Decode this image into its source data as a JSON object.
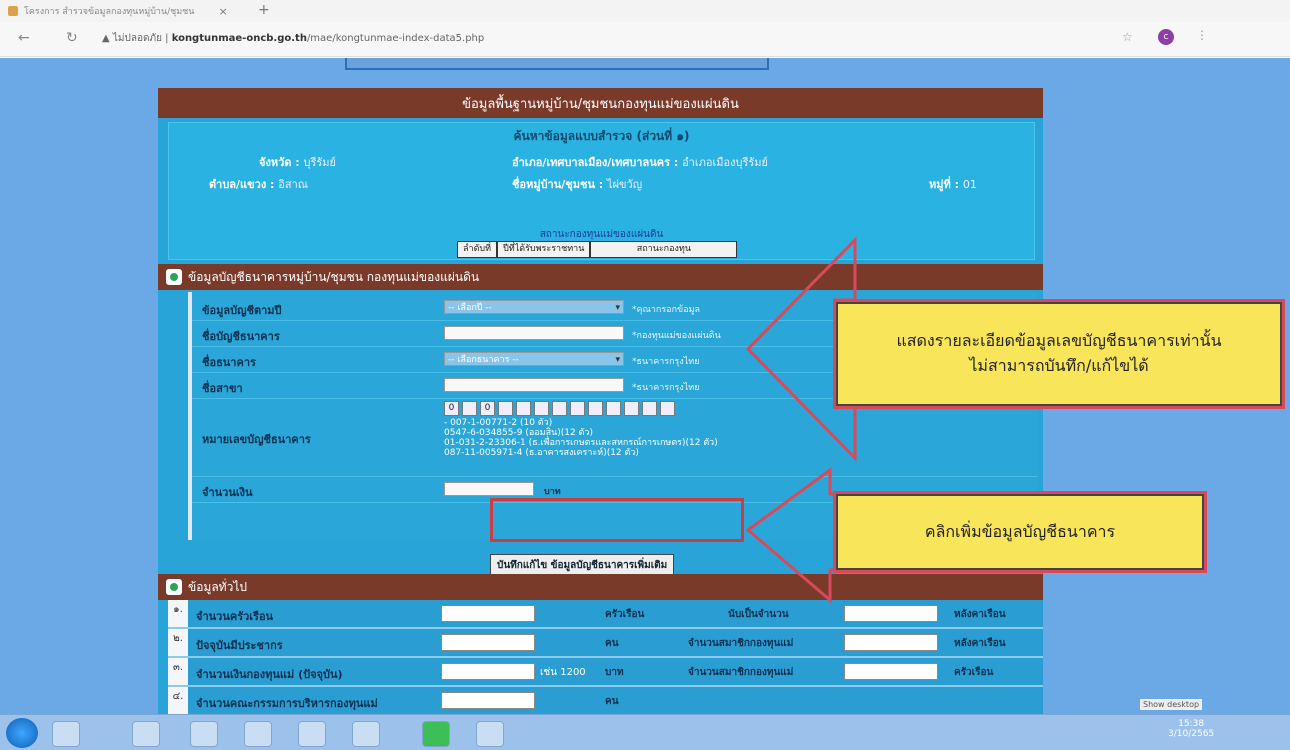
{
  "browser": {
    "tab_title": "โครงการ สำรวจข้อมูลกองทุนหมู่บ้าน/ชุมชน",
    "tab_close": "×",
    "new_tab": "+",
    "url_security": "ไม่ปลอดภัย",
    "url_host": "kongtunmae-oncb.go.th",
    "url_path": "/mae/kongtunmae-index-data5.php",
    "profile_initial": "c"
  },
  "page": {
    "main_header": "ข้อมูลพื้นฐานหมู่บ้าน/ชุมชนกองทุนแม่ของแผ่นดิน",
    "survey_title": "ค้นหาข้อมูลแบบสำรวจ (ส่วนที่ ๑)",
    "info": {
      "province_label": "จังหวัด :",
      "province_value": "บุรีรัมย์",
      "district_label": "อำเภอ/เทศบาลเมือง/เทศบาลนคร :",
      "district_value": "อำเภอเมืองบุรีรัมย์",
      "subdistrict_label": "ตำบล/แขวง :",
      "subdistrict_value": "อิสาณ",
      "village_label": "ชื่อหมู่บ้าน/ชุมชน :",
      "village_value": "ไผ่ขวัญ",
      "moo_label": "หมู่ที่ :",
      "moo_value": "01"
    },
    "status_label": "สถานะกองทุนแม่ของแผ่นดิน",
    "status_buttons": [
      "ลำดับที่",
      "ปีที่ได้รับพระราชทาน",
      "สถานะกองทุน"
    ]
  },
  "bank_section": {
    "title": "ข้อมูลบัญชีธนาคารหมู่บ้าน/ชุมชน กองทุนแม่ของแผ่นดิน",
    "rows": [
      {
        "label": "ข้อมูลบัญชีตามปี",
        "kind": "select",
        "value": "-- เลือกปี --",
        "note": "*คุณากรอกข้อมูล"
      },
      {
        "label": "ชื่อบัญชีธนาคาร",
        "kind": "input",
        "value": "",
        "note": "*กองทุนแม่ของแผ่นดิน"
      },
      {
        "label": "ชื่อธนาคาร",
        "kind": "select",
        "value": "-- เลือกธนาคาร --",
        "note": "*ธนาคารกรุงไทย"
      },
      {
        "label": "ชื่อสาขา",
        "kind": "input",
        "value": "",
        "note": "*ธนาคารกรุงไทย"
      }
    ],
    "account_label": "หมายเลขบัญชีธนาคาร",
    "account_digits": [
      "0",
      "",
      "0",
      "",
      "",
      "",
      "",
      "",
      "",
      "",
      "",
      "",
      ""
    ],
    "account_examples": "- 007-1-00771-2 (10 ตัว)\n0547-6-034855-9 (ออมสิน)(12 ตัว)\n01-031-2-23306-1 (ธ.เพื่อการเกษตรและสหกรณ์การเกษตร)(12 ตัว)\n087-11-005971-4 (ธ.อาคารสงเคราะห์)(12 ตัว)",
    "amount_label": "จำนวนเงิน",
    "amount_unit": "บาท",
    "save_button": "บันทึกแก้ไข ข้อมูลบัญชีธนาคารเพิ่มเติม"
  },
  "general_section": {
    "title": "ข้อมูลทั่วไป",
    "rows": [
      {
        "num": "๑.",
        "label": "จำนวนครัวเรือน",
        "unit": "ครัวเรือน",
        "label2": "นับเป็นจำนวน",
        "unit2": "หลังคาเรือน"
      },
      {
        "num": "๒.",
        "label": "ปัจจุบันมีประชากร",
        "unit": "คน",
        "label2": "จำนวนสมาชิกกองทุนแม่",
        "unit2": "หลังคาเรือน"
      },
      {
        "num": "๓.",
        "label": "จำนวนเงินกองทุนแม่ (ปัจจุบัน)",
        "extra": "เช่น 1200",
        "unit": "บาท",
        "label2": "จำนวนสมาชิกกองทุนแม่",
        "unit2": "ครัวเรือน"
      },
      {
        "num": "๔.",
        "label": "จำนวนคณะกรรมการบริหารกองทุนแม่",
        "unit": "คน",
        "label2": "",
        "unit2": ""
      }
    ]
  },
  "callouts": {
    "top_line1": "แสดงรายละเอียดข้อมูลเลขบัญชีธนาคารเท่านั้น",
    "top_line2": "ไม่สามารถบันทึก/แก้ไขได้",
    "bottom": "คลิกเพิ่มข้อมูลบัญชีธนาคาร"
  },
  "taskbar": {
    "show_desktop": "Show desktop",
    "time": "15:38",
    "date": "3/10/2565"
  }
}
